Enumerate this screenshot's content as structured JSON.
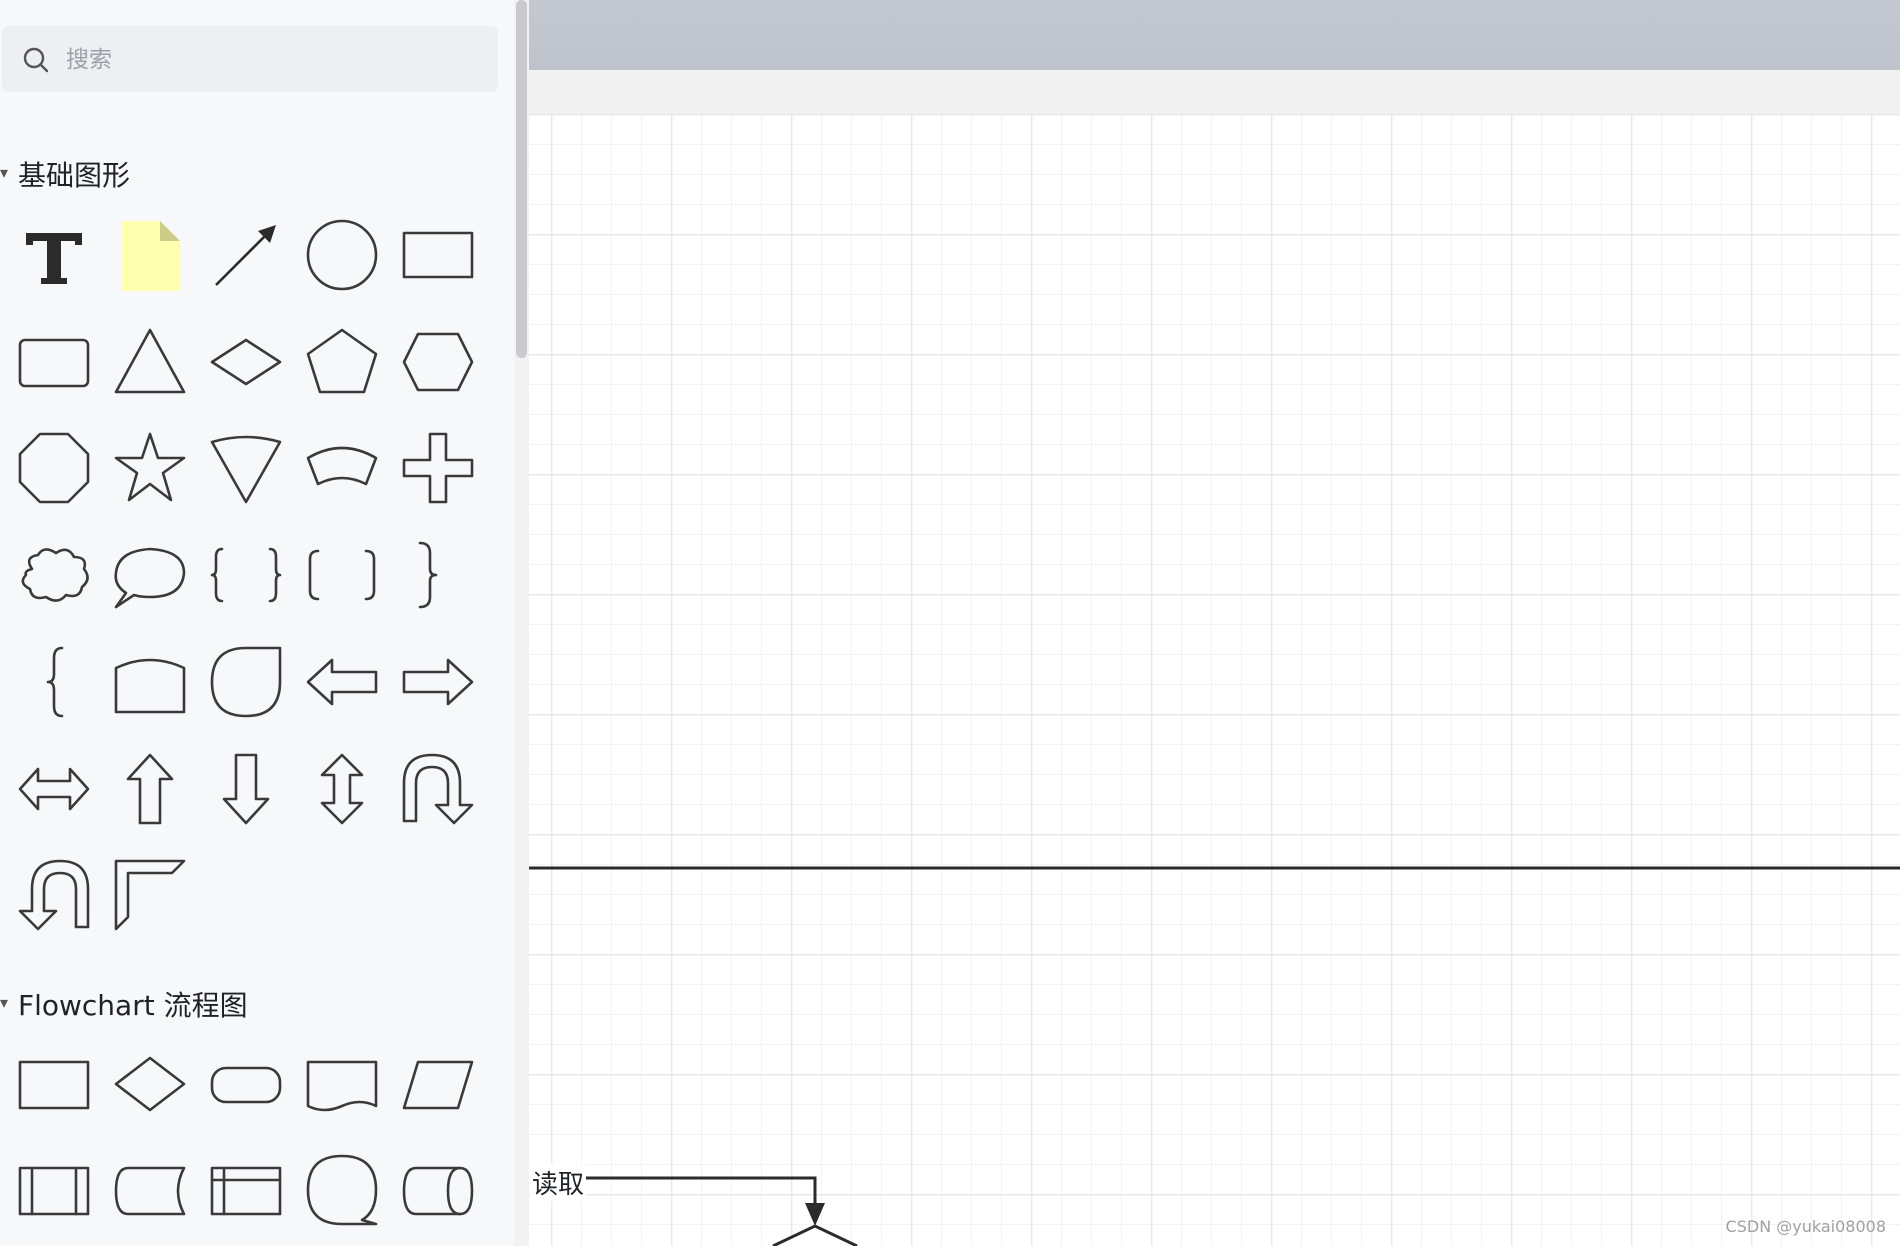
{
  "search": {
    "placeholder": "搜索"
  },
  "sections": {
    "basic": {
      "title": "基础图形"
    },
    "flowchart": {
      "title": "Flowchart 流程图"
    }
  },
  "canvas": {
    "edge_label": "读取",
    "watermark": "CSDN @yukai08008"
  },
  "colors": {
    "sticky_note": "#ffffb0",
    "stroke": "#3a3a3a",
    "topbar": "#c4c8d0"
  }
}
